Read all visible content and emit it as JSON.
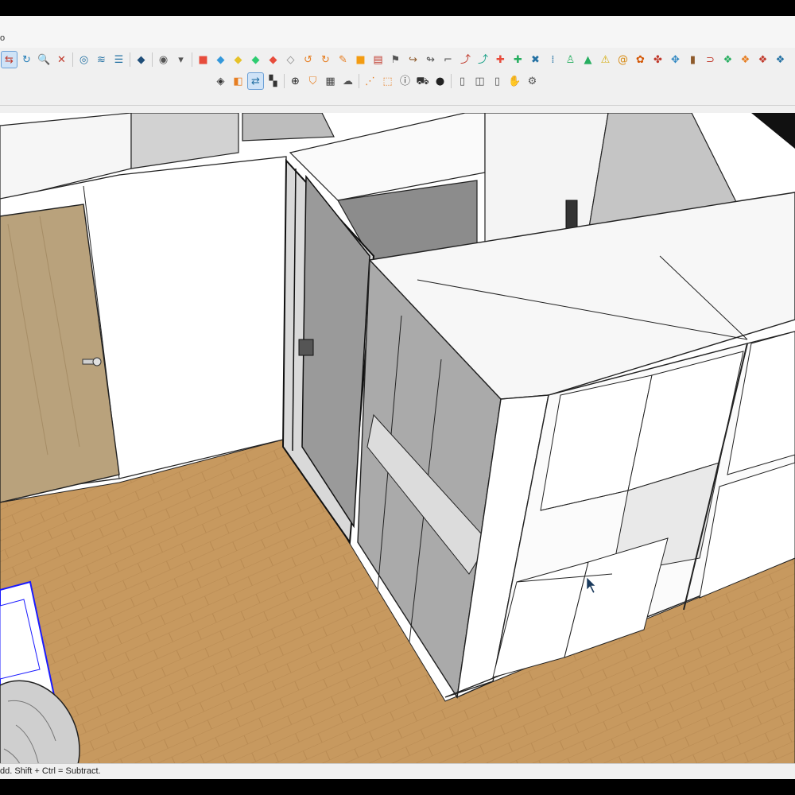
{
  "window": {
    "menu_fragment": "o"
  },
  "toolbar": {
    "row1": [
      {
        "name": "select-icon",
        "glyph": "⇆",
        "color": "#c0392b",
        "active": true
      },
      {
        "name": "orbit-icon",
        "glyph": "↻",
        "color": "#2980b9",
        "active": false
      },
      {
        "name": "zoom-icon",
        "glyph": "🔍",
        "color": "#333333",
        "active": false
      },
      {
        "name": "zoom-extents-icon",
        "glyph": "✕",
        "color": "#c0392b",
        "active": false
      },
      {
        "sep": true
      },
      {
        "name": "styles-icon",
        "glyph": "◎",
        "color": "#2471a3",
        "active": false
      },
      {
        "name": "sections-icon",
        "glyph": "≋",
        "color": "#2471a3",
        "active": false
      },
      {
        "name": "layers-icon",
        "glyph": "☰",
        "color": "#2471a3",
        "active": false
      },
      {
        "sep": true
      },
      {
        "name": "components-icon",
        "glyph": "◆",
        "color": "#1f4e79",
        "active": false
      },
      {
        "sep": true
      },
      {
        "name": "location-icon",
        "glyph": "◉",
        "color": "#555555",
        "active": false
      },
      {
        "name": "dropdown-arrow-icon",
        "glyph": "▾",
        "color": "#555555",
        "active": false
      },
      {
        "sep": true
      },
      {
        "name": "red-box-icon",
        "glyph": "■",
        "color": "#e74c3c",
        "active": false
      },
      {
        "name": "blue-box-icon",
        "glyph": "◆",
        "color": "#3498db",
        "active": false
      },
      {
        "name": "yellow-box-icon",
        "glyph": "◆",
        "color": "#e6c229",
        "active": false
      },
      {
        "name": "green-box-icon",
        "glyph": "◆",
        "color": "#2ecc71",
        "active": false
      },
      {
        "name": "red-diamond-icon",
        "glyph": "◆",
        "color": "#e74c3c",
        "active": false
      },
      {
        "name": "white-diamond-icon",
        "glyph": "◇",
        "color": "#888888",
        "active": false
      },
      {
        "name": "rotate-orange-icon",
        "glyph": "↺",
        "color": "#e67e22",
        "active": false
      },
      {
        "name": "loop-orange-icon",
        "glyph": "↻",
        "color": "#e67e22",
        "active": false
      },
      {
        "name": "twist-icon",
        "glyph": "✎",
        "color": "#e67e22",
        "active": false
      },
      {
        "name": "orange-square-icon",
        "glyph": "■",
        "color": "#f39c12",
        "active": false
      },
      {
        "name": "grid-red-icon",
        "glyph": "▤",
        "color": "#c0392b",
        "active": false
      },
      {
        "name": "flag-icon",
        "glyph": "⚑",
        "color": "#555555",
        "active": false
      },
      {
        "name": "bend-icon",
        "glyph": "↪",
        "color": "#8e5a2b",
        "active": false
      },
      {
        "name": "pipe-icon",
        "glyph": "↬",
        "color": "#555555",
        "active": false
      },
      {
        "name": "corner-icon",
        "glyph": "⌐",
        "color": "#555555",
        "active": false
      },
      {
        "name": "curve-red-icon",
        "glyph": "⤴",
        "color": "#c0392b",
        "active": false
      },
      {
        "name": "curve-teal-icon",
        "glyph": "⤴",
        "color": "#16a085",
        "active": false
      },
      {
        "name": "red-cross-icon",
        "glyph": "✚",
        "color": "#e74c3c",
        "active": false
      },
      {
        "name": "green-cross-icon",
        "glyph": "✚",
        "color": "#27ae60",
        "active": false
      },
      {
        "name": "blue-x-icon",
        "glyph": "✖",
        "color": "#2471a3",
        "active": false
      },
      {
        "name": "dot-grid-icon",
        "glyph": "⁞",
        "color": "#2471a3",
        "active": false
      },
      {
        "name": "figure-icon",
        "glyph": "♙",
        "color": "#27ae60",
        "active": false
      },
      {
        "name": "triangle-icon",
        "glyph": "▲",
        "color": "#27ae60",
        "active": false
      },
      {
        "name": "warning-icon",
        "glyph": "⚠",
        "color": "#d4ac0d",
        "active": false
      },
      {
        "name": "spiral-icon",
        "glyph": "@",
        "color": "#d68910",
        "active": false
      },
      {
        "name": "bell-icon",
        "glyph": "✿",
        "color": "#d35400",
        "active": false
      },
      {
        "name": "pin-icon",
        "glyph": "✤",
        "color": "#c0392b",
        "active": false
      },
      {
        "name": "move-arrows-icon",
        "glyph": "✥",
        "color": "#2e86c1",
        "active": false
      },
      {
        "name": "barrel-icon",
        "glyph": "▮",
        "color": "#8e5a2b",
        "active": false
      },
      {
        "name": "magnet-icon",
        "glyph": "⊃",
        "color": "#c0392b",
        "active": false
      },
      {
        "name": "cube-green-icon",
        "glyph": "❖",
        "color": "#27ae60",
        "active": false
      },
      {
        "name": "cube-orange-icon",
        "glyph": "❖",
        "color": "#e67e22",
        "active": false
      },
      {
        "name": "cube-red-icon",
        "glyph": "❖",
        "color": "#c0392b",
        "active": false
      },
      {
        "name": "cube-multi-icon",
        "glyph": "❖",
        "color": "#2471a3",
        "active": false
      }
    ],
    "row2": [
      {
        "name": "paint-bucket-icon",
        "glyph": "◈",
        "color": "#333333",
        "active": false
      },
      {
        "name": "material-orange-icon",
        "glyph": "◧",
        "color": "#e67e22",
        "active": false
      },
      {
        "name": "swap-icon",
        "glyph": "⇄",
        "color": "#2471a3",
        "active": true
      },
      {
        "name": "cluster-icon",
        "glyph": "▚",
        "color": "#333333",
        "active": false
      },
      {
        "sep": true
      },
      {
        "name": "add-circle-icon",
        "glyph": "⊕",
        "color": "#222222",
        "active": false
      },
      {
        "name": "shield-icon",
        "glyph": "⛉",
        "color": "#e67e22",
        "active": false
      },
      {
        "name": "checker-icon",
        "glyph": "▦",
        "color": "#444444",
        "active": false
      },
      {
        "name": "cloud-icon",
        "glyph": "☁",
        "color": "#555555",
        "active": false
      },
      {
        "sep": true
      },
      {
        "name": "dimension-icon",
        "glyph": "⋰",
        "color": "#e67e22",
        "active": false
      },
      {
        "name": "frame-icon",
        "glyph": "⬚",
        "color": "#e67e22",
        "active": false
      },
      {
        "name": "info-icon",
        "glyph": "ⓘ",
        "color": "#333333",
        "active": false
      },
      {
        "name": "cart-icon",
        "glyph": "⛟",
        "color": "#333333",
        "active": false
      },
      {
        "name": "account-icon",
        "glyph": "●",
        "color": "#222222",
        "active": false
      },
      {
        "sep": true
      },
      {
        "name": "panel-left-icon",
        "glyph": "▯",
        "color": "#555555",
        "active": false
      },
      {
        "name": "panel-book-icon",
        "glyph": "◫",
        "color": "#555555",
        "active": false
      },
      {
        "name": "panel-right-icon",
        "glyph": "▯",
        "color": "#555555",
        "active": false
      },
      {
        "name": "hand-icon",
        "glyph": "✋",
        "color": "#333333",
        "active": false
      },
      {
        "name": "settings-gear-icon",
        "glyph": "⚙",
        "color": "#555555",
        "active": false
      }
    ]
  },
  "status": {
    "hint": "dd. Shift + Ctrl = Subtract."
  },
  "colors": {
    "floor": "#c7995f",
    "door": "#b9a27c",
    "wall": "#ffffff",
    "glass": "#8f8f8f",
    "cabinet": "#fbfbfb",
    "selection": "#1a1aff"
  }
}
